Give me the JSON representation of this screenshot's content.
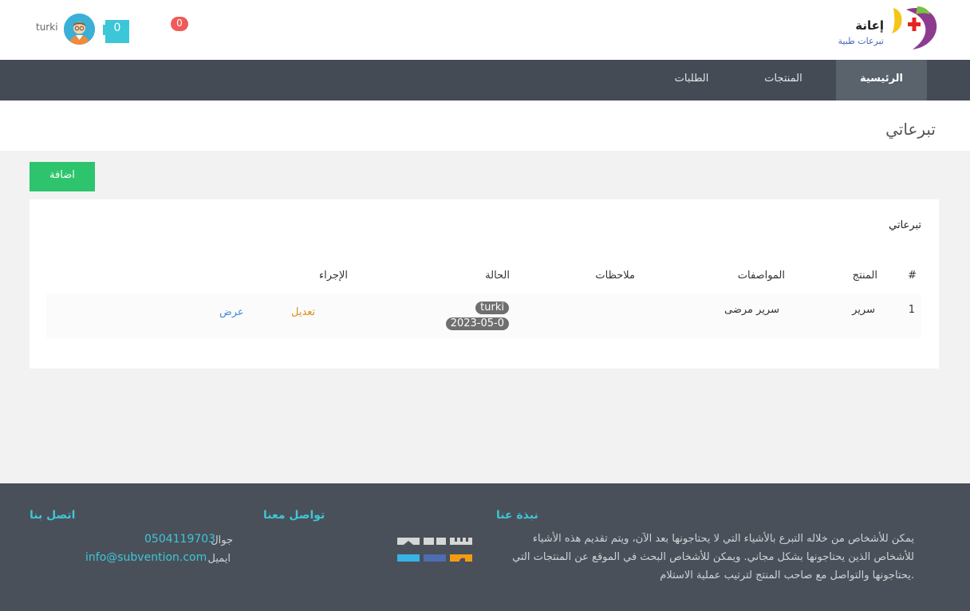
{
  "header": {
    "logo_title": "إعانة",
    "logo_subtitle": "تبرعات طبية",
    "user_name": "turki",
    "cart_count": "0",
    "notification_count": "0"
  },
  "nav": {
    "items": [
      {
        "label": "الرئيسية",
        "active": true
      },
      {
        "label": "المنتجات",
        "active": false
      },
      {
        "label": "الطلبات",
        "active": false
      }
    ]
  },
  "page": {
    "title": "تبرعاتي",
    "add_button": "اضافة"
  },
  "table": {
    "caption": "تبرعاتي",
    "headers": {
      "index": "#",
      "product": "المنتج",
      "specs": "المواصفات",
      "notes": "ملاحظات",
      "status": "الحالة",
      "action": "الإجراء"
    },
    "rows": [
      {
        "index": "1",
        "product": "سرير",
        "specs": "سرير مرضى",
        "notes": "",
        "status_user": "turki",
        "status_date": "2023-05-0",
        "edit": "تعديل",
        "view": "عرض"
      }
    ]
  },
  "footer": {
    "about_title": "نبذة عنا",
    "about_text": "يمكن للأشخاص من خلاله التبرع بالأشياء التي لا يحتاجونها بعد الآن، ويتم تقديم هذه الأشياء للأشخاص الذين يحتاجونها بشكل مجاني. ويمكن للأشخاص البحث في الموقع عن المنتجات التي يحتاجونها والتواصل مع صاحب المنتج لترتيب عملية الاستلام.",
    "social_title": "تواصل معنا",
    "contact_title": "اتصل بنا",
    "phone_label": "جوال",
    "phone_value": "0504119703",
    "email_label": "ايميل",
    "email_value": "info@subvention.com"
  },
  "colors": {
    "accent": "#3cc6d8",
    "add_button": "#2dc46d",
    "nav_bg": "#444b55",
    "footer_bg": "#4a5059",
    "edit_link": "#e08c1a",
    "view_link": "#3d8bd4",
    "notification": "#f05a5a"
  }
}
